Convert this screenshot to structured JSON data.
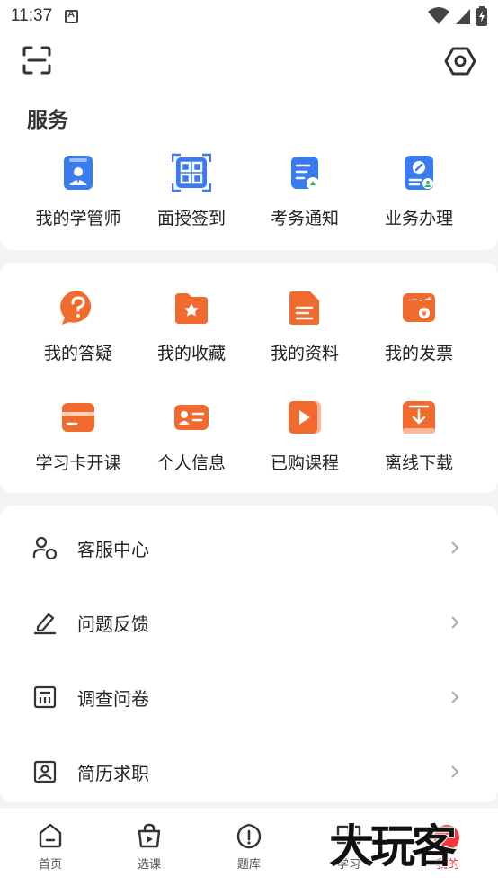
{
  "status": {
    "time": "11:37"
  },
  "services": {
    "title": "服务",
    "items": [
      {
        "label": "我的学管师",
        "icon": "advisor-icon"
      },
      {
        "label": "面授签到",
        "icon": "qr-signin-icon"
      },
      {
        "label": "考务通知",
        "icon": "exam-notice-icon"
      },
      {
        "label": "业务办理",
        "icon": "business-icon"
      }
    ]
  },
  "personal": {
    "items": [
      {
        "label": "我的答疑",
        "icon": "question-bubble-icon"
      },
      {
        "label": "我的收藏",
        "icon": "favorite-folder-icon"
      },
      {
        "label": "我的资料",
        "icon": "document-icon"
      },
      {
        "label": "我的发票",
        "icon": "invoice-icon"
      },
      {
        "label": "学习卡开课",
        "icon": "study-card-icon"
      },
      {
        "label": "个人信息",
        "icon": "id-card-icon"
      },
      {
        "label": "已购课程",
        "icon": "video-course-icon"
      },
      {
        "label": "离线下载",
        "icon": "download-icon"
      }
    ]
  },
  "menu": {
    "items": [
      {
        "label": "客服中心",
        "icon": "customer-service-icon"
      },
      {
        "label": "问题反馈",
        "icon": "feedback-pen-icon"
      },
      {
        "label": "调查问卷",
        "icon": "survey-icon"
      },
      {
        "label": "简历求职",
        "icon": "resume-icon"
      }
    ]
  },
  "tabs": [
    {
      "label": "首页",
      "icon": "home-icon"
    },
    {
      "label": "选课",
      "icon": "course-bag-icon"
    },
    {
      "label": "题库",
      "icon": "question-bank-icon"
    },
    {
      "label": "学习",
      "icon": "study-book-icon"
    },
    {
      "label": "我的",
      "icon": "profile-icon"
    }
  ],
  "watermark": "大玩客",
  "colors": {
    "blue": "#3a7bf0",
    "orange": "#f26b2e",
    "red": "#e53935"
  }
}
